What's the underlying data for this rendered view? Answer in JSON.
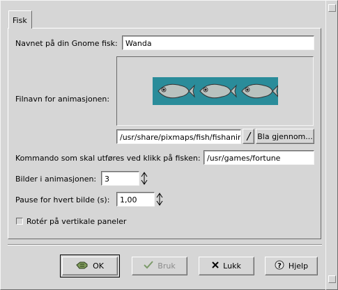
{
  "tab": {
    "label": "Fisk"
  },
  "form": {
    "name_label": "Navnet på din Gnome fisk:",
    "name_value": "Wanda",
    "anim_label": "Filnavn for animasjonen:",
    "anim_path": "/usr/share/pixmaps/fish/fishanim",
    "browse_label": "Bla gjennom...",
    "command_label": "Kommando som skal utføres ved klikk på fisken:",
    "command_value": "/usr/games/fortune",
    "frames_label": "Bilder i animasjonen:",
    "frames_value": "3",
    "pause_label": "Pause for hvert bilde (s):",
    "pause_value": "1,00",
    "rotate_label": "Rotér på vertikale paneler",
    "rotate_checked": false
  },
  "buttons": {
    "ok": "OK",
    "apply": "Bruk",
    "close": "Lukk",
    "help": "Hjelp"
  },
  "icons": {
    "ok": "ok-hand-icon",
    "apply": "checkmark-icon",
    "close": "x-close-icon",
    "help": "question-mark-icon"
  },
  "colors": {
    "window_bg": "#d6d6d6",
    "fish_water": "#2a8c9a"
  }
}
